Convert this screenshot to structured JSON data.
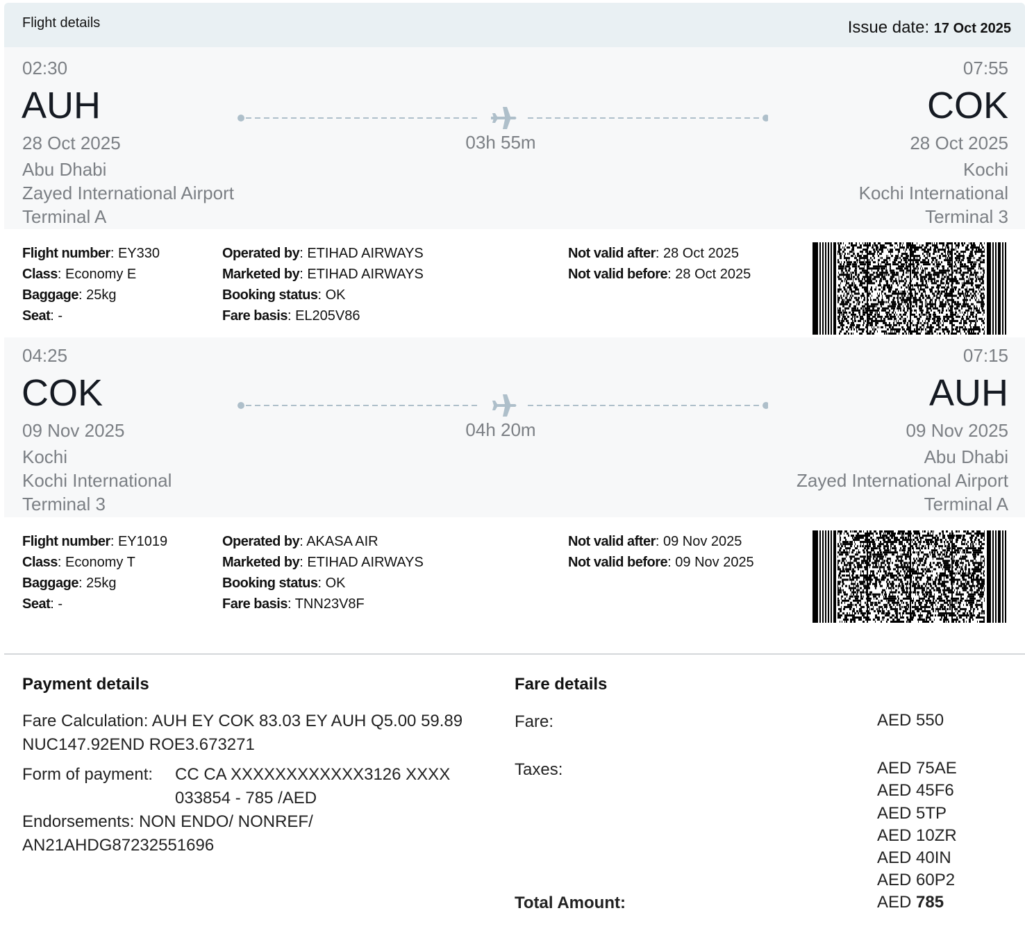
{
  "header": {
    "title": "Flight details",
    "issue_label": "Issue date:",
    "issue_date": "17 Oct 2025"
  },
  "segments": [
    {
      "dep_time": "02:30",
      "arr_time": "07:55",
      "dep_code": "AUH",
      "arr_code": "COK",
      "dep_date": "28 Oct 2025",
      "arr_date": "28 Oct 2025",
      "dep_city": "Abu Dhabi",
      "arr_city": "Kochi",
      "dep_airport": "Zayed International Airport",
      "arr_airport": "Kochi International",
      "dep_terminal": "Terminal A",
      "arr_terminal": "Terminal 3",
      "duration": "03h 55m",
      "flight_number_label": "Flight number",
      "flight_number": "EY330",
      "class_label": "Class",
      "class": "Economy E",
      "baggage_label": "Baggage",
      "baggage": "25kg",
      "seat_label": "Seat",
      "seat": "-",
      "operated_label": "Operated by",
      "operated": "ETIHAD AIRWAYS",
      "marketed_label": "Marketed by",
      "marketed": "ETIHAD AIRWAYS",
      "booking_label": "Booking status",
      "booking": "OK",
      "fare_basis_label": "Fare basis",
      "fare_basis": "EL205V86",
      "nva_label": "Not valid after",
      "nva": "28 Oct 2025",
      "nvb_label": "Not valid before",
      "nvb": "28 Oct 2025"
    },
    {
      "dep_time": "04:25",
      "arr_time": "07:15",
      "dep_code": "COK",
      "arr_code": "AUH",
      "dep_date": "09 Nov 2025",
      "arr_date": "09 Nov 2025",
      "dep_city": "Kochi",
      "arr_city": "Abu Dhabi",
      "dep_airport": "Kochi International",
      "arr_airport": "Zayed International Airport",
      "dep_terminal": "Terminal 3",
      "arr_terminal": "Terminal A",
      "duration": "04h 20m",
      "flight_number_label": "Flight number",
      "flight_number": "EY1019",
      "class_label": "Class",
      "class": "Economy T",
      "baggage_label": "Baggage",
      "baggage": "25kg",
      "seat_label": "Seat",
      "seat": "-",
      "operated_label": "Operated by",
      "operated": "AKASA AIR",
      "marketed_label": "Marketed by",
      "marketed": "ETIHAD AIRWAYS",
      "booking_label": "Booking status",
      "booking": "OK",
      "fare_basis_label": "Fare basis",
      "fare_basis": "TNN23V8F",
      "nva_label": "Not valid after",
      "nva": "09 Nov 2025",
      "nvb_label": "Not valid before",
      "nvb": "09 Nov 2025"
    }
  ],
  "payment": {
    "title": "Payment details",
    "fare_calc_line1": "Fare Calculation: AUH EY COK 83.03 EY AUH Q5.00 59.89",
    "fare_calc_line2": "NUC147.92END ROE3.673271",
    "fop_label": "Form of payment:",
    "fop_line1": "CC CA XXXXXXXXXXXX3126 XXXX",
    "fop_line2": "033854 - 785 /AED",
    "endorse_line1": "Endorsements: NON ENDO/ NONREF/",
    "endorse_line2": "AN21AHDG87232551696"
  },
  "fare": {
    "title": "Fare details",
    "fare_label": "Fare:",
    "fare_value": "AED 550",
    "taxes_label": "Taxes:",
    "taxes": [
      "AED 75AE",
      "AED 45F6",
      "AED 5TP",
      "AED 10ZR",
      "AED 40IN",
      "AED 60P2"
    ],
    "total_label": "Total Amount:",
    "total_currency": "AED",
    "total_value": "785"
  },
  "colors": {
    "header_bg": "#e9f0f3",
    "segment_bg": "#f7f8f9",
    "route_line": "#aebfca"
  },
  "icons": {
    "route": "airplane-icon"
  }
}
